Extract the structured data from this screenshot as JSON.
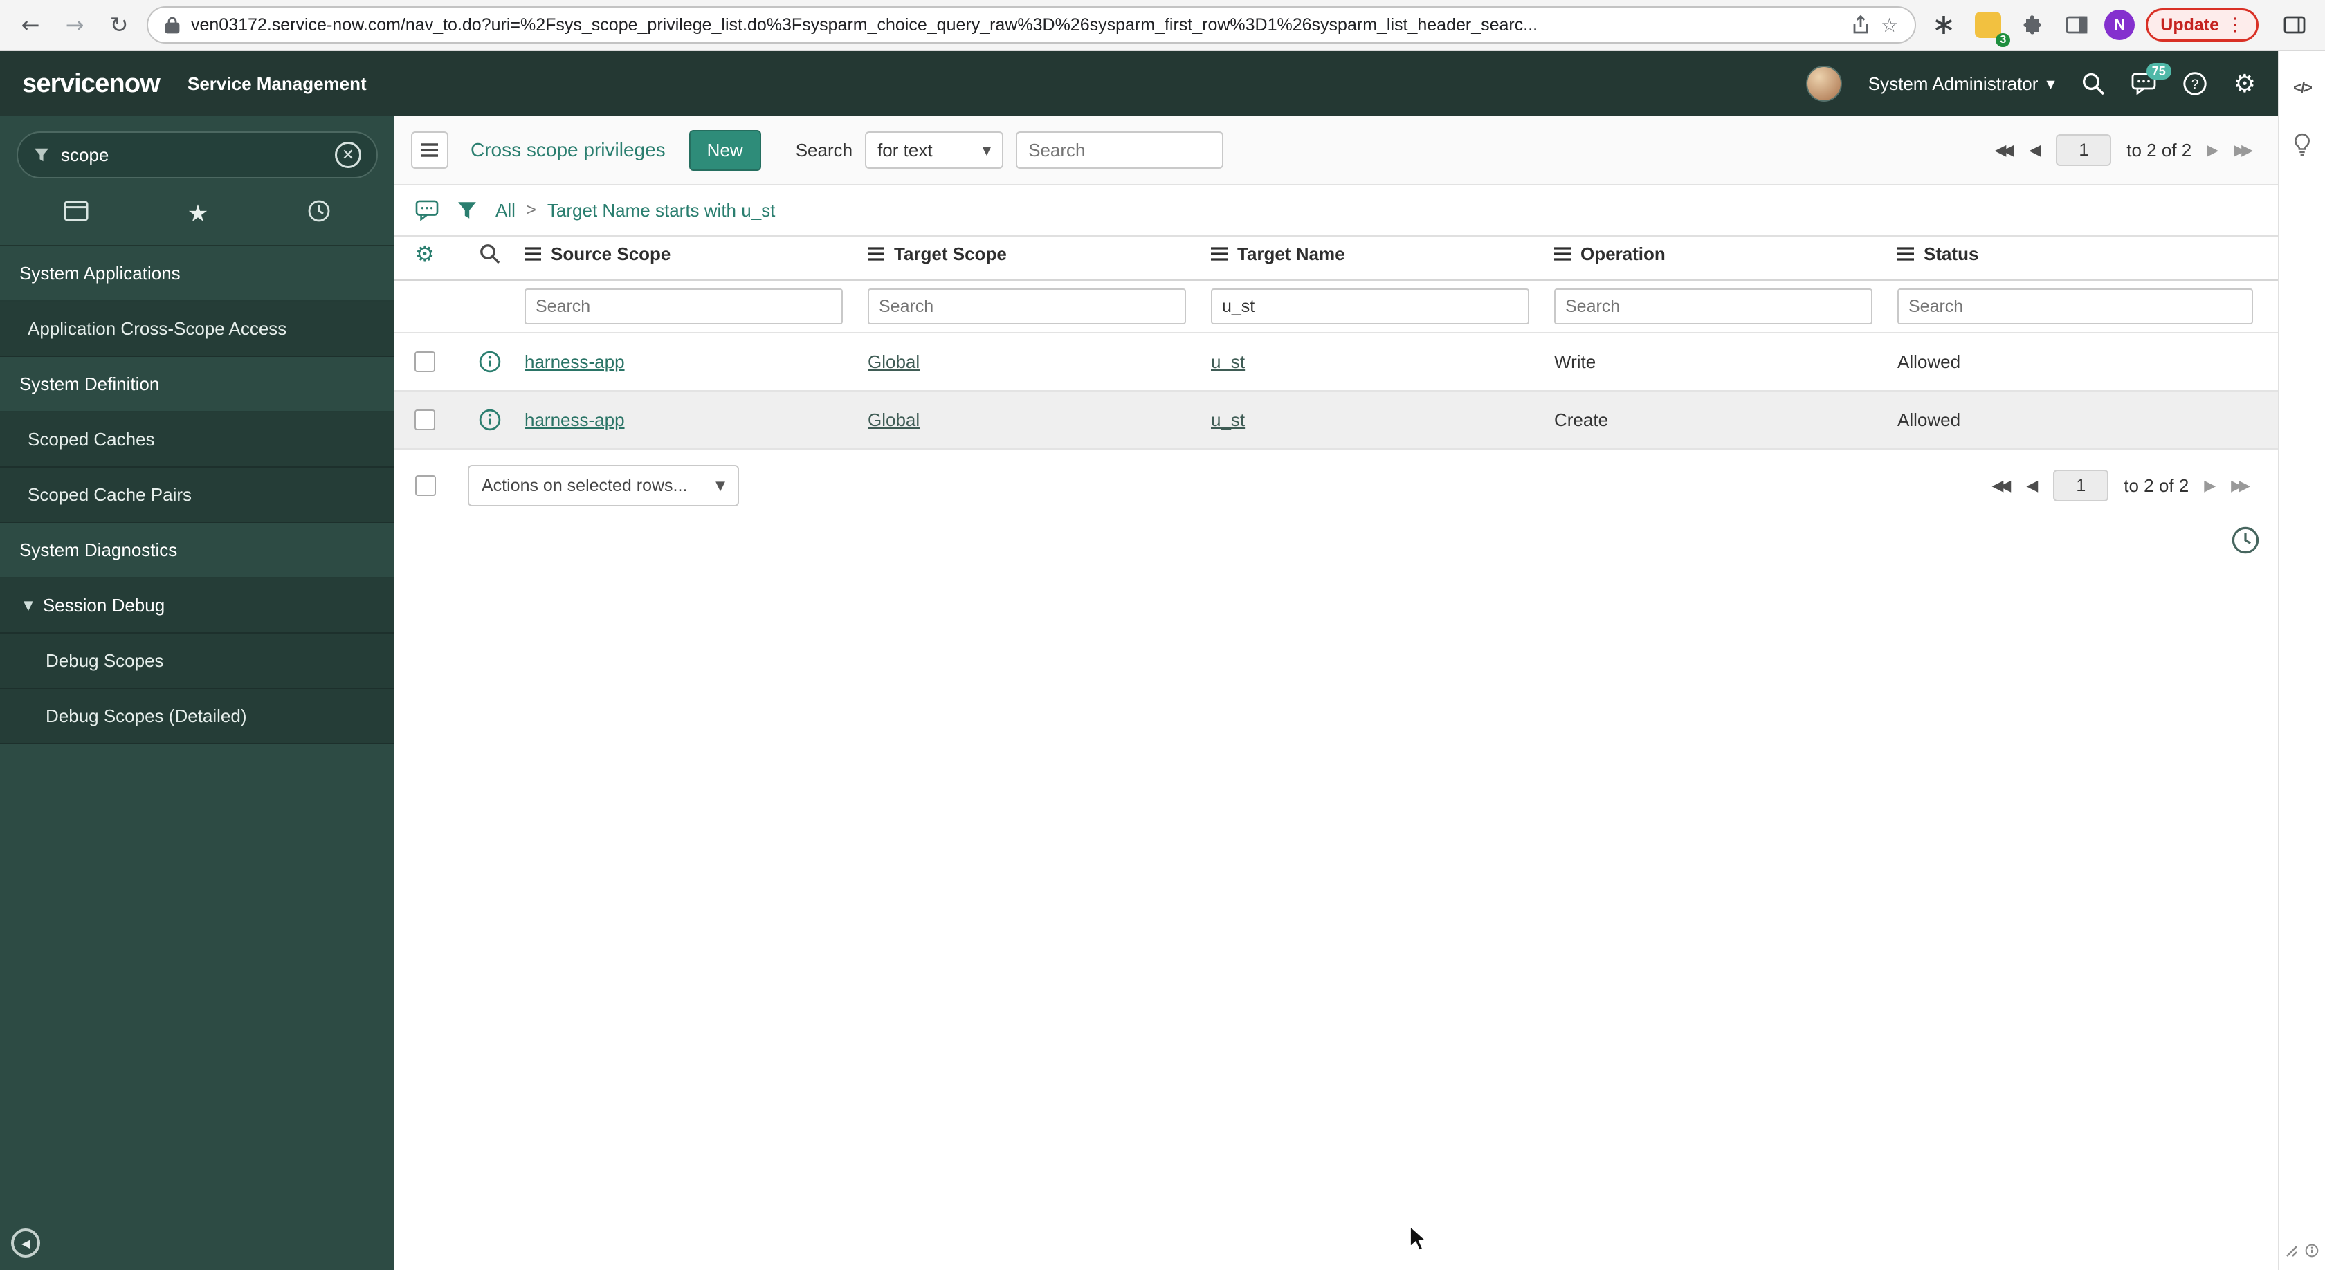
{
  "browser": {
    "url": "ven03172.service-now.com/nav_to.do?uri=%2Fsys_scope_privilege_list.do%3Fsysparm_choice_query_raw%3D%26sysparm_first_row%3D1%26sysparm_list_header_searc...",
    "update_button": "Update",
    "extension_badge": "3",
    "profile_initial": "N"
  },
  "icons": {
    "back": "←",
    "forward": "→",
    "reload": "↻",
    "star_outline": "☆",
    "menu_dots": "⋮",
    "gear": "⚙",
    "star": "★",
    "caret_down": "▼",
    "expanded": "▼",
    "first": "◀◀",
    "prev": "◀",
    "next": "▶",
    "last": "▶▶",
    "collapse": "◀",
    "code": "</>"
  },
  "header": {
    "logo": "servicenow",
    "product": "Service Management",
    "user_name": "System Administrator",
    "notification_count": "75"
  },
  "sidebar": {
    "filter_value": "scope",
    "items": [
      {
        "label": "System Applications"
      },
      {
        "label": "Application Cross-Scope Access"
      },
      {
        "label": "System Definition"
      },
      {
        "label": "Scoped Caches"
      },
      {
        "label": "Scoped Cache Pairs"
      },
      {
        "label": "System Diagnostics"
      },
      {
        "label": "Session Debug"
      },
      {
        "label": "Debug Scopes"
      },
      {
        "label": "Debug Scopes (Detailed)"
      }
    ]
  },
  "list": {
    "title": "Cross scope privileges",
    "new_button": "New",
    "search_label": "Search",
    "search_type": "for text",
    "search_placeholder": "Search",
    "breadcrumb_all": "All",
    "breadcrumb_sep": ">",
    "breadcrumb_filter": "Target Name starts with u_st",
    "page_value": "1",
    "page_range": "to 2 of 2",
    "columns": [
      "Source Scope",
      "Target Scope",
      "Target Name",
      "Operation",
      "Status"
    ],
    "target_name_filter": "u_st",
    "rows": [
      {
        "source_scope": "harness-app",
        "target_scope": "Global",
        "target_name": "u_st",
        "operation": "Write",
        "status": "Allowed"
      },
      {
        "source_scope": "harness-app",
        "target_scope": "Global",
        "target_name": "u_st",
        "operation": "Create",
        "status": "Allowed"
      }
    ],
    "actions_placeholder": "Actions on selected rows..."
  }
}
